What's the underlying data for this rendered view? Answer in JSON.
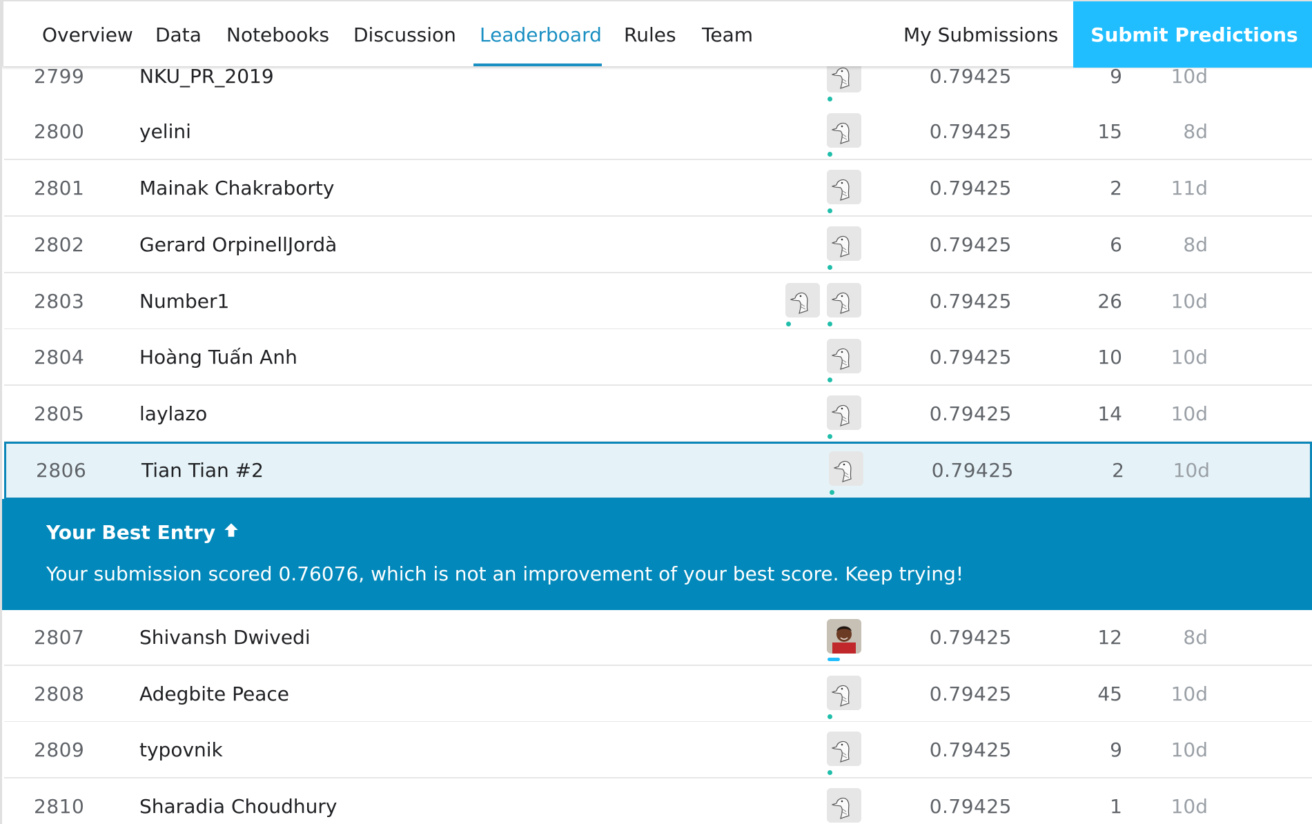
{
  "nav": {
    "tabs": [
      "Overview",
      "Data",
      "Notebooks",
      "Discussion",
      "Leaderboard",
      "Rules",
      "Team"
    ],
    "active_tab": "Leaderboard",
    "my_submissions": "My Submissions",
    "submit_label": "Submit Predictions"
  },
  "rows_before": [
    {
      "rank": "2799",
      "team": "NKU_PR_2019",
      "score": "0.79425",
      "entries": "9",
      "last": "10d",
      "avatars": 1
    },
    {
      "rank": "2800",
      "team": "yelini",
      "score": "0.79425",
      "entries": "15",
      "last": "8d",
      "avatars": 1
    },
    {
      "rank": "2801",
      "team": "Mainak Chakraborty",
      "score": "0.79425",
      "entries": "2",
      "last": "11d",
      "avatars": 1
    },
    {
      "rank": "2802",
      "team": "Gerard OrpinellJordà",
      "score": "0.79425",
      "entries": "6",
      "last": "8d",
      "avatars": 1
    },
    {
      "rank": "2803",
      "team": "Number1",
      "score": "0.79425",
      "entries": "26",
      "last": "10d",
      "avatars": 2
    },
    {
      "rank": "2804",
      "team": "Hoàng Tuấn Anh",
      "score": "0.79425",
      "entries": "10",
      "last": "10d",
      "avatars": 1
    },
    {
      "rank": "2805",
      "team": "laylazo",
      "score": "0.79425",
      "entries": "14",
      "last": "10d",
      "avatars": 1
    }
  ],
  "my_row": {
    "rank": "2806",
    "team": "Tian Tian #2",
    "score": "0.79425",
    "entries": "2",
    "last": "10d",
    "avatars": 1
  },
  "banner": {
    "title": "Your Best Entry",
    "message": "Your submission scored 0.76076, which is not an improvement of your best score. Keep trying!"
  },
  "rows_after": [
    {
      "rank": "2807",
      "team": "Shivansh Dwivedi",
      "score": "0.79425",
      "entries": "12",
      "last": "8d",
      "avatars": 1,
      "photo": true
    },
    {
      "rank": "2808",
      "team": "Adegbite Peace",
      "score": "0.79425",
      "entries": "45",
      "last": "10d",
      "avatars": 1
    },
    {
      "rank": "2809",
      "team": "typovnik",
      "score": "0.79425",
      "entries": "9",
      "last": "10d",
      "avatars": 1
    },
    {
      "rank": "2810",
      "team": "Sharadia Choudhury",
      "score": "0.79425",
      "entries": "1",
      "last": "10d",
      "avatars": 1
    }
  ],
  "colors": {
    "accent": "#1a8fc2",
    "banner": "#0288ba",
    "submit": "#20beff",
    "highlight_row": "#e5f3f8",
    "tier_dot": "#20beaa"
  }
}
